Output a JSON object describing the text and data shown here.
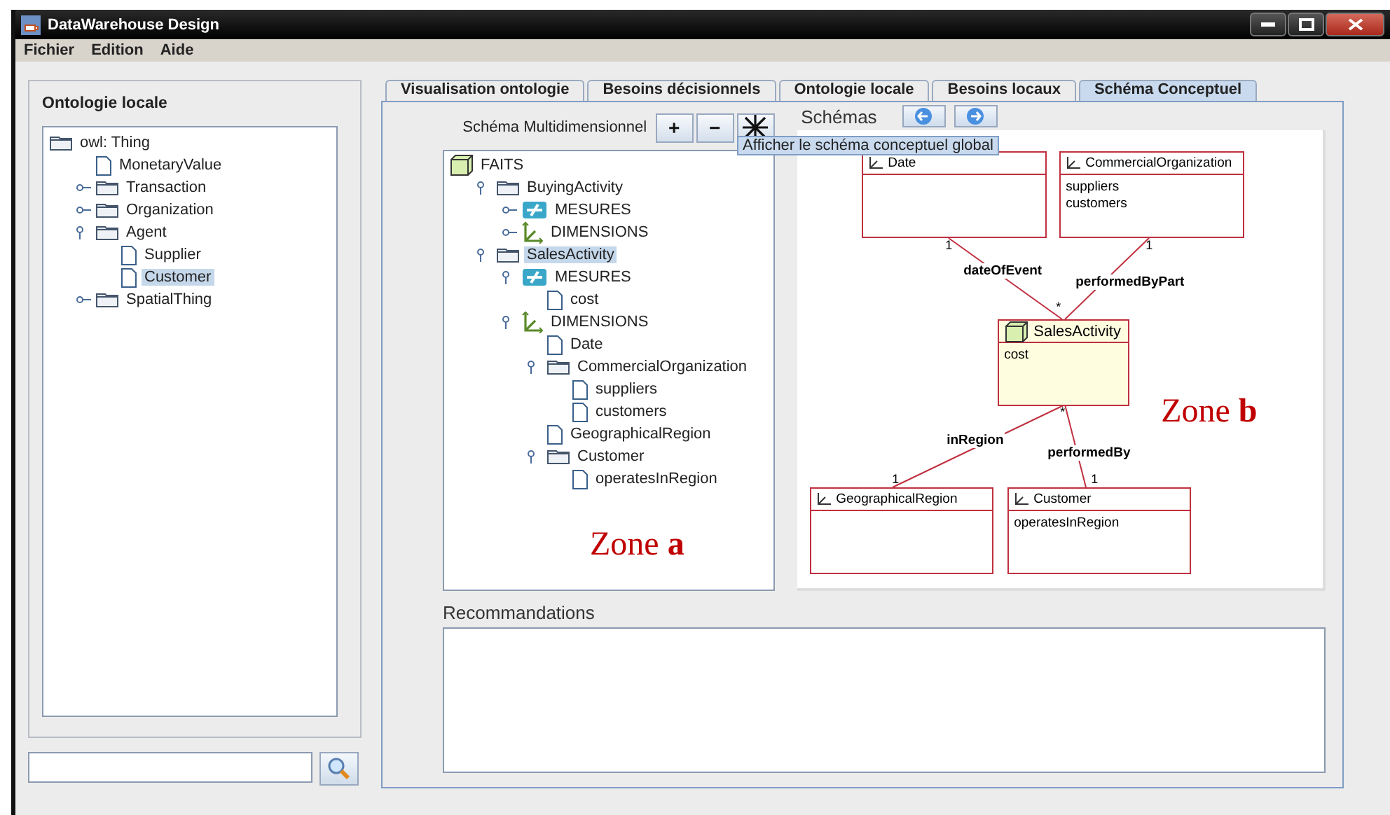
{
  "window": {
    "title": "DataWarehouse Design"
  },
  "menu": [
    "Fichier",
    "Edition",
    "Aide"
  ],
  "ontology_panel": {
    "title": "Ontologie locale",
    "tree": [
      {
        "label": "owl: Thing",
        "kind": "folder",
        "selected": false,
        "children": [
          {
            "label": "MonetaryValue",
            "kind": "file",
            "selected": false
          },
          {
            "label": "Transaction",
            "kind": "folder",
            "selected": false,
            "expanded": false
          },
          {
            "label": "Organization",
            "kind": "folder",
            "selected": false,
            "expanded": false
          },
          {
            "label": "Agent",
            "kind": "folder",
            "selected": false,
            "expanded": true,
            "children": [
              {
                "label": "Supplier",
                "kind": "file",
                "selected": false
              },
              {
                "label": "Customer",
                "kind": "file",
                "selected": true
              }
            ]
          },
          {
            "label": "SpatialThing",
            "kind": "folder",
            "selected": false,
            "expanded": false
          }
        ]
      }
    ]
  },
  "tabs": [
    {
      "label": "Visualisation ontologie",
      "selected": false
    },
    {
      "label": "Besoins décisionnels",
      "selected": false
    },
    {
      "label": "Ontologie locale",
      "selected": false
    },
    {
      "label": "Besoins locaux",
      "selected": false
    },
    {
      "label": "Schéma Conceptuel",
      "selected": true
    }
  ],
  "multidimensional": {
    "label": "Schéma Multidimensionnel",
    "buttons": [
      "+",
      "−"
    ],
    "tooltip": "Afficher le schéma conceptuel global",
    "zone_label": "Zone **a**",
    "tree": [
      {
        "label": "FAITS",
        "kind": "cube",
        "selected": false,
        "children": [
          {
            "label": "BuyingActivity",
            "kind": "folder",
            "selected": false,
            "expanded": true,
            "children": [
              {
                "label": "MESURES",
                "kind": "measures",
                "selected": false,
                "expanded": false
              },
              {
                "label": "DIMENSIONS",
                "kind": "dimensions",
                "selected": false,
                "expanded": false
              }
            ]
          },
          {
            "label": "SalesActivity",
            "kind": "folder",
            "selected": true,
            "expanded": true,
            "children": [
              {
                "label": "MESURES",
                "kind": "measures",
                "selected": false,
                "expanded": true,
                "children": [
                  {
                    "label": "cost",
                    "kind": "file",
                    "selected": false
                  }
                ]
              },
              {
                "label": "DIMENSIONS",
                "kind": "dimensions",
                "selected": false,
                "expanded": true,
                "children": [
                  {
                    "label": "Date",
                    "kind": "file",
                    "selected": false
                  },
                  {
                    "label": "CommercialOrganization",
                    "kind": "folder",
                    "selected": false,
                    "expanded": true,
                    "children": [
                      {
                        "label": "suppliers",
                        "kind": "file",
                        "selected": false
                      },
                      {
                        "label": "customers",
                        "kind": "file",
                        "selected": false
                      }
                    ]
                  },
                  {
                    "label": "GeographicalRegion",
                    "kind": "file",
                    "selected": false
                  },
                  {
                    "label": "Customer",
                    "kind": "folder",
                    "selected": false,
                    "expanded": true,
                    "children": [
                      {
                        "label": "operatesInRegion",
                        "kind": "file",
                        "selected": false
                      }
                    ]
                  }
                ]
              }
            ]
          }
        ]
      }
    ]
  },
  "schemas": {
    "label": "Schémas",
    "zone_label": "Zone **b**",
    "classes": [
      {
        "name": "Date",
        "kind": "dimension"
      },
      {
        "name": "CommercialOrganization",
        "kind": "dimension",
        "attributes": [
          "suppliers",
          "customers"
        ]
      },
      {
        "name": "SalesActivity",
        "kind": "fact",
        "attributes": [
          "cost"
        ]
      },
      {
        "name": "GeographicalRegion",
        "kind": "dimension"
      },
      {
        "name": "Customer",
        "kind": "dimension",
        "attributes": [
          "operatesInRegion"
        ]
      }
    ],
    "associations": [
      {
        "name": "dateOfEvent",
        "dimension_multiplicity": "1",
        "fact_multiplicity": "*"
      },
      {
        "name": "performedByPart",
        "dimension_multiplicity": "1"
      },
      {
        "name": "inRegion",
        "dimension_multiplicity": "1",
        "fact_multiplicity": "*"
      },
      {
        "name": "performedBy",
        "dimension_multiplicity": "1"
      }
    ]
  },
  "recommendations": {
    "label": "Recommandations"
  }
}
